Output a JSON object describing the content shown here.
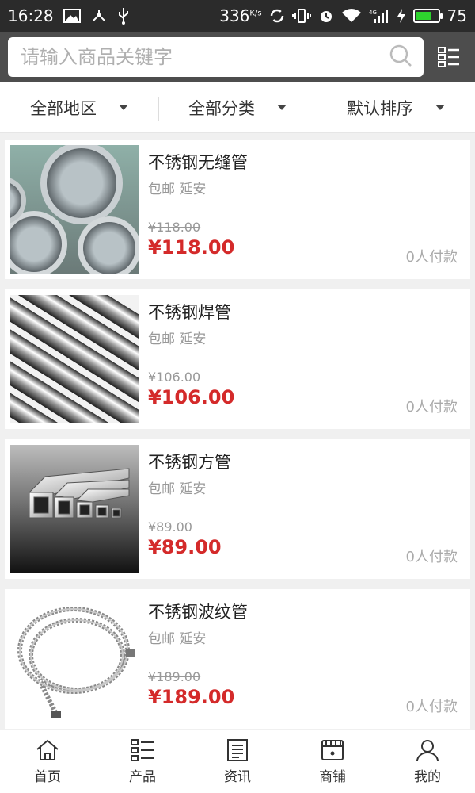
{
  "status_bar": {
    "time": "16:28",
    "net_speed": "336",
    "net_speed_unit": "K/s",
    "battery_level": "75",
    "battery_fraction": 0.75
  },
  "search": {
    "placeholder": "请输入商品关键字",
    "value": ""
  },
  "filters": [
    {
      "label": "全部地区"
    },
    {
      "label": "全部分类"
    },
    {
      "label": "默认排序"
    }
  ],
  "products": [
    {
      "title": "不锈钢无缝管",
      "shipping": "包邮",
      "location": "延安",
      "old_price": "¥118.00",
      "price": "¥118.00",
      "paid": "0人付款",
      "image_icon": "steel-round-pipes"
    },
    {
      "title": "不锈钢焊管",
      "shipping": "包邮",
      "location": "延安",
      "old_price": "¥106.00",
      "price": "¥106.00",
      "paid": "0人付款",
      "image_icon": "steel-welded-pipes"
    },
    {
      "title": "不锈钢方管",
      "shipping": "包邮",
      "location": "延安",
      "old_price": "¥89.00",
      "price": "¥89.00",
      "paid": "0人付款",
      "image_icon": "steel-square-tubes"
    },
    {
      "title": "不锈钢波纹管",
      "shipping": "包邮",
      "location": "延安",
      "old_price": "¥189.00",
      "price": "¥189.00",
      "paid": "0人付款",
      "image_icon": "steel-corrugated-hose"
    }
  ],
  "bottom_nav": [
    {
      "label": "首页",
      "icon": "home-icon"
    },
    {
      "label": "产品",
      "icon": "list-icon"
    },
    {
      "label": "资讯",
      "icon": "news-icon"
    },
    {
      "label": "商铺",
      "icon": "store-icon"
    },
    {
      "label": "我的",
      "icon": "user-icon"
    }
  ],
  "colors": {
    "header_bg": "#4d4d4d",
    "status_bg": "#2b2b2b",
    "price_red": "#d42a2a",
    "battery_green": "#2ed42e"
  }
}
